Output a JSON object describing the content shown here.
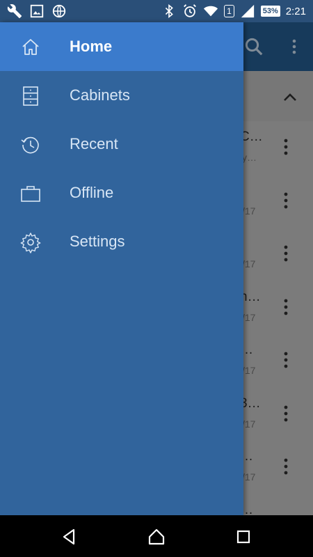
{
  "status_bar": {
    "icons_left": [
      "wrench-icon",
      "image-icon",
      "globe-icon"
    ],
    "icons_right": [
      "bluetooth-icon",
      "alarm-icon",
      "wifi-icon",
      "sim-icon",
      "signal-icon"
    ],
    "sim_badge": "1",
    "battery": "53%",
    "time": "2:21"
  },
  "drawer": {
    "items": [
      {
        "label": "Home",
        "icon": "home-icon",
        "active": true
      },
      {
        "label": "Cabinets",
        "icon": "cabinet-icon",
        "active": false
      },
      {
        "label": "Recent",
        "icon": "history-icon",
        "active": false
      },
      {
        "label": "Offline",
        "icon": "briefcase-icon",
        "active": false
      },
      {
        "label": "Settings",
        "icon": "gear-icon",
        "active": false
      }
    ]
  },
  "background_list": {
    "rows": [
      {
        "title": "C…",
        "sub": "y…"
      },
      {
        "title": "",
        "sub": "/17"
      },
      {
        "title": "",
        "sub": "/17"
      },
      {
        "title": "n…",
        "sub": "/17"
      },
      {
        "title": "…",
        "sub": "/17"
      },
      {
        "title": "3…",
        "sub": "/17"
      },
      {
        "title": "…",
        "sub": "/17"
      },
      {
        "title": "…",
        "sub": ""
      }
    ]
  },
  "colors": {
    "drawer_bg": "#31649c",
    "drawer_active": "#3b7bcc",
    "toolbar": "#173a5b"
  }
}
